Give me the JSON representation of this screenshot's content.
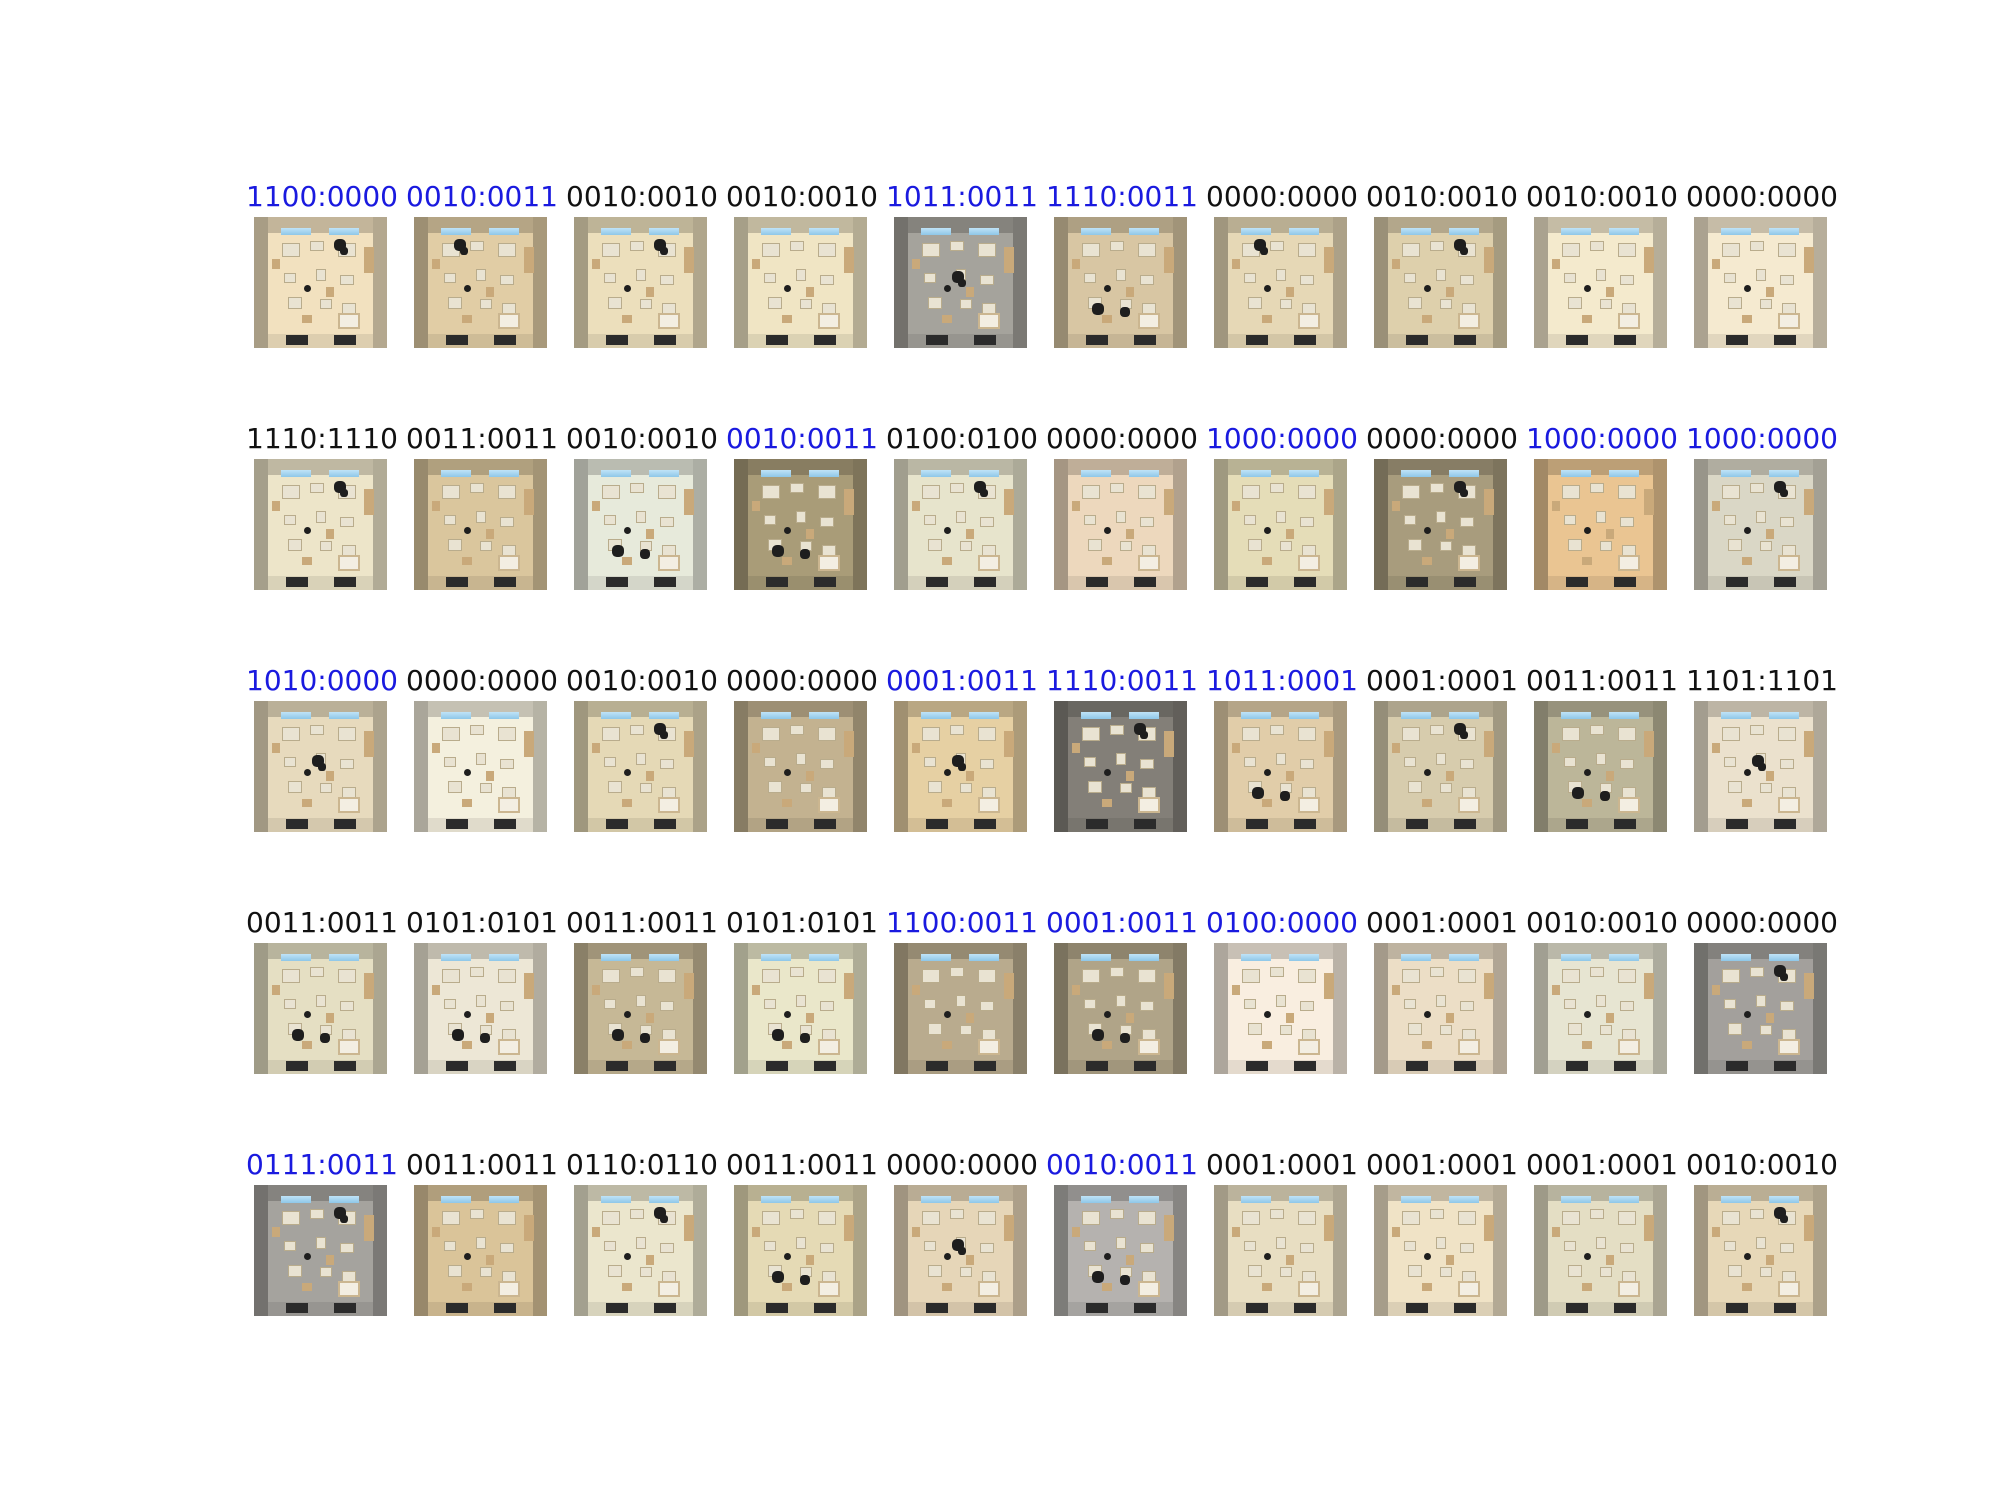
{
  "colors": {
    "highlight_label": "#1a1adf",
    "normal_label": "#111111"
  },
  "rows": [
    {
      "cells": [
        {
          "label": "1100:0000",
          "highlight": true,
          "tone": "#cdbfa2",
          "people": "top-right"
        },
        {
          "label": "0010:0011",
          "highlight": true,
          "tone": "#bfae8c",
          "people": "top-left"
        },
        {
          "label": "0010:0010",
          "highlight": false,
          "tone": "#c8bd9f",
          "people": "top-right"
        },
        {
          "label": "0010:0010",
          "highlight": false,
          "tone": "#cbc2a6",
          "people": "none"
        },
        {
          "label": "1011:0011",
          "highlight": true,
          "tone": "#8c8a84",
          "people": "center"
        },
        {
          "label": "1110:0011",
          "highlight": true,
          "tone": "#b7a88a",
          "people": "bottom-left"
        },
        {
          "label": "0000:0000",
          "highlight": false,
          "tone": "#c3b79a",
          "people": "top-left"
        },
        {
          "label": "0010:0010",
          "highlight": false,
          "tone": "#bcb092",
          "people": "top-right"
        },
        {
          "label": "0010:0010",
          "highlight": false,
          "tone": "#cfc6ae",
          "people": "none"
        },
        {
          "label": "0000:0000",
          "highlight": false,
          "tone": "#d0c6b0",
          "people": "none"
        }
      ]
    },
    {
      "cells": [
        {
          "label": "1110:1110",
          "highlight": false,
          "tone": "#c9c2aa",
          "people": "top-right"
        },
        {
          "label": "0011:0011",
          "highlight": false,
          "tone": "#b9a885",
          "people": "none"
        },
        {
          "label": "0010:0010",
          "highlight": false,
          "tone": "#c4c6ba",
          "people": "bottom-left"
        },
        {
          "label": "0010:0011",
          "highlight": true,
          "tone": "#8f8466",
          "people": "bottom-left"
        },
        {
          "label": "0100:0100",
          "highlight": false,
          "tone": "#c4c1ad",
          "people": "top-right"
        },
        {
          "label": "0000:0000",
          "highlight": false,
          "tone": "#c9b7a0",
          "people": "none"
        },
        {
          "label": "1000:0000",
          "highlight": true,
          "tone": "#c2bb9c",
          "people": "none"
        },
        {
          "label": "0000:0000",
          "highlight": false,
          "tone": "#8e846a",
          "people": "top-right"
        },
        {
          "label": "1000:0000",
          "highlight": true,
          "tone": "#c6a77c",
          "people": "none"
        },
        {
          "label": "1000:0000",
          "highlight": true,
          "tone": "#b9b6a8",
          "people": "top-right"
        }
      ]
    },
    {
      "cells": [
        {
          "label": "1010:0000",
          "highlight": true,
          "tone": "#c4b9a0",
          "people": "center"
        },
        {
          "label": "0000:0000",
          "highlight": false,
          "tone": "#cfcbbc",
          "people": "none"
        },
        {
          "label": "0010:0010",
          "highlight": false,
          "tone": "#c2b89a",
          "people": "top-right"
        },
        {
          "label": "0000:0000",
          "highlight": false,
          "tone": "#a5977a",
          "people": "none"
        },
        {
          "label": "0001:0011",
          "highlight": true,
          "tone": "#c3b08a",
          "people": "center"
        },
        {
          "label": "1110:0011",
          "highlight": true,
          "tone": "#6f6c66",
          "people": "top-right"
        },
        {
          "label": "1011:0001",
          "highlight": true,
          "tone": "#bfae8f",
          "people": "bottom-left"
        },
        {
          "label": "0001:0001",
          "highlight": false,
          "tone": "#b6ad93",
          "people": "top-right"
        },
        {
          "label": "0011:0011",
          "highlight": false,
          "tone": "#9f9a82",
          "people": "bottom-left"
        },
        {
          "label": "1101:1101",
          "highlight": false,
          "tone": "#c7bfae",
          "people": "center"
        }
      ]
    },
    {
      "cells": [
        {
          "label": "0011:0011",
          "highlight": false,
          "tone": "#c2bda5",
          "people": "bottom-left"
        },
        {
          "label": "0101:0101",
          "highlight": false,
          "tone": "#c9c4b5",
          "people": "bottom-left"
        },
        {
          "label": "0011:0011",
          "highlight": false,
          "tone": "#a89c7f",
          "people": "bottom-left"
        },
        {
          "label": "0101:0101",
          "highlight": false,
          "tone": "#c6c4ab",
          "people": "bottom-left"
        },
        {
          "label": "1100:0011",
          "highlight": true,
          "tone": "#9d9178",
          "people": "none"
        },
        {
          "label": "0001:0011",
          "highlight": true,
          "tone": "#958b73",
          "people": "bottom-left"
        },
        {
          "label": "0100:0000",
          "highlight": true,
          "tone": "#d3cabe",
          "people": "none"
        },
        {
          "label": "0001:0001",
          "highlight": false,
          "tone": "#c8bca8",
          "people": "none"
        },
        {
          "label": "0010:0010",
          "highlight": false,
          "tone": "#c4c2b2",
          "people": "none"
        },
        {
          "label": "0000:0000",
          "highlight": false,
          "tone": "#8a8884",
          "people": "top-right"
        }
      ]
    },
    {
      "cells": [
        {
          "label": "0111:0011",
          "highlight": true,
          "tone": "#8c8a86",
          "people": "top-right"
        },
        {
          "label": "0011:0011",
          "highlight": false,
          "tone": "#b9a682",
          "people": "none"
        },
        {
          "label": "0110:0110",
          "highlight": false,
          "tone": "#c7c3ae",
          "people": "top-right"
        },
        {
          "label": "0011:0011",
          "highlight": false,
          "tone": "#c2b999",
          "people": "bottom-left"
        },
        {
          "label": "0000:0000",
          "highlight": false,
          "tone": "#c3b59c",
          "people": "center"
        },
        {
          "label": "0010:0011",
          "highlight": true,
          "tone": "#999794",
          "people": "bottom-left"
        },
        {
          "label": "0001:0001",
          "highlight": false,
          "tone": "#c5bca4",
          "people": "none"
        },
        {
          "label": "0001:0001",
          "highlight": false,
          "tone": "#cbc0a8",
          "people": "none"
        },
        {
          "label": "0001:0001",
          "highlight": false,
          "tone": "#c1bca6",
          "people": "none"
        },
        {
          "label": "0010:0010",
          "highlight": false,
          "tone": "#c4b79c",
          "people": "top-right"
        }
      ]
    }
  ]
}
